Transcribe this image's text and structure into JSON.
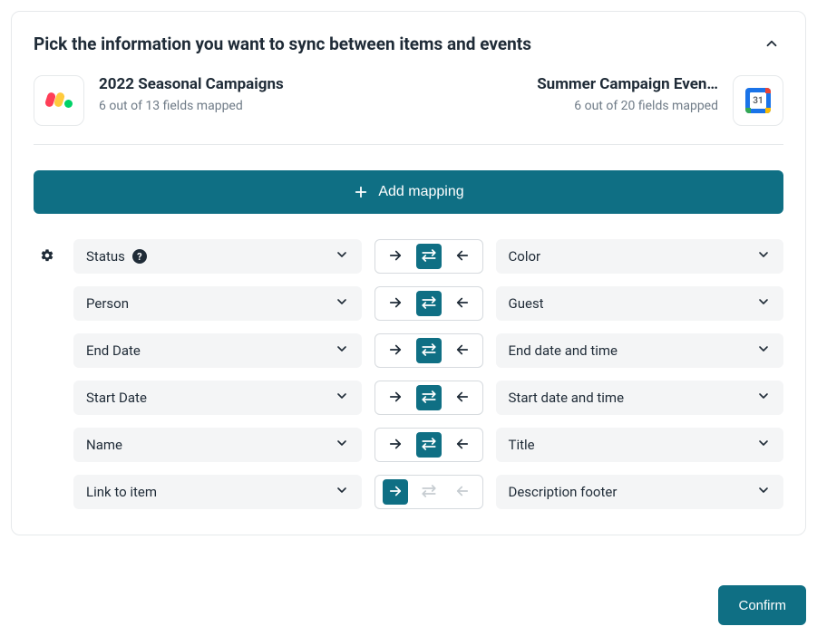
{
  "header": {
    "title": "Pick the information you want to sync between items and events"
  },
  "left_source": {
    "title": "2022 Seasonal Campaigns",
    "subtitle": "6 out of 13 fields mapped",
    "icon": "monday-icon"
  },
  "right_source": {
    "title": "Summer Campaign Even…",
    "subtitle": "6 out of 20 fields mapped",
    "icon": "google-calendar-icon",
    "day_label": "31"
  },
  "add_button": {
    "label": "Add mapping"
  },
  "mappings": [
    {
      "left": "Status",
      "left_help": true,
      "show_gear": true,
      "right": "Color",
      "direction": "both"
    },
    {
      "left": "Person",
      "left_help": false,
      "show_gear": false,
      "right": "Guest",
      "direction": "both"
    },
    {
      "left": "End Date",
      "left_help": false,
      "show_gear": false,
      "right": "End date and time",
      "direction": "both"
    },
    {
      "left": "Start Date",
      "left_help": false,
      "show_gear": false,
      "right": "Start date and time",
      "direction": "both"
    },
    {
      "left": "Name",
      "left_help": false,
      "show_gear": false,
      "right": "Title",
      "direction": "both"
    },
    {
      "left": "Link to item",
      "left_help": false,
      "show_gear": false,
      "right": "Description footer",
      "direction": "right"
    }
  ],
  "confirm": {
    "label": "Confirm"
  },
  "colors": {
    "accent": "#0f6f84"
  }
}
